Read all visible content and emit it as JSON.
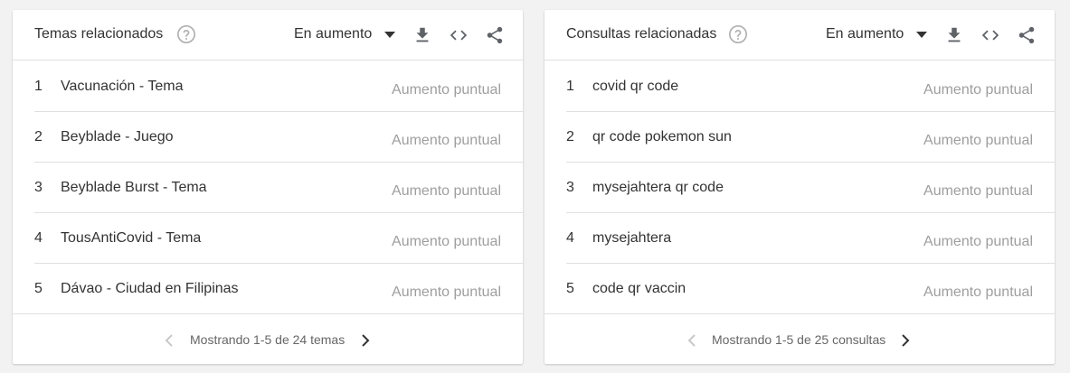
{
  "panels": [
    {
      "title": "Temas relacionados",
      "filter": "En aumento",
      "rows": [
        {
          "rank": "1",
          "label": "Vacunación - Tema",
          "value": "Aumento puntual"
        },
        {
          "rank": "2",
          "label": "Beyblade - Juego",
          "value": "Aumento puntual"
        },
        {
          "rank": "3",
          "label": "Beyblade Burst - Tema",
          "value": "Aumento puntual"
        },
        {
          "rank": "4",
          "label": "TousAntiCovid - Tema",
          "value": "Aumento puntual"
        },
        {
          "rank": "5",
          "label": "Dávao - Ciudad en Filipinas",
          "value": "Aumento puntual"
        }
      ],
      "pagination": "Mostrando 1-5 de 24 temas"
    },
    {
      "title": "Consultas relacionadas",
      "filter": "En aumento",
      "rows": [
        {
          "rank": "1",
          "label": "covid qr code",
          "value": "Aumento puntual"
        },
        {
          "rank": "2",
          "label": "qr code pokemon sun",
          "value": "Aumento puntual"
        },
        {
          "rank": "3",
          "label": "mysejahtera qr code",
          "value": "Aumento puntual"
        },
        {
          "rank": "4",
          "label": "mysejahtera",
          "value": "Aumento puntual"
        },
        {
          "rank": "5",
          "label": "code qr vaccin",
          "value": "Aumento puntual"
        }
      ],
      "pagination": "Mostrando 1-5 de 25 consultas"
    }
  ],
  "icons": {
    "help": "help-circle-icon",
    "dropdown": "caret-down-icon",
    "download": "download-icon",
    "embed": "code-embed-icon",
    "share": "share-icon",
    "prev": "chevron-left-icon",
    "next": "chevron-right-icon"
  },
  "colors": {
    "text": "#333333",
    "muted": "#9e9e9e",
    "icon": "#5f6368",
    "disabled": "#c8c8c8",
    "divider": "#e0e0e0"
  }
}
